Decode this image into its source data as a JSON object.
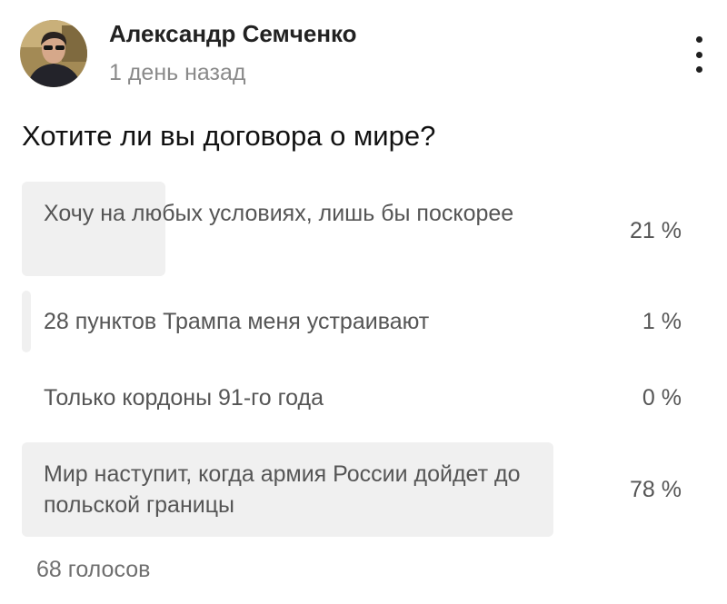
{
  "post": {
    "author": "Александр Семченко",
    "time": "1 день назад",
    "avatar_icon": "person-photo-avatar",
    "menu_icon": "vertical-dots-icon"
  },
  "poll": {
    "question": "Хотите ли вы договора о мире?",
    "fill_color": "#f0f0f0",
    "options": [
      {
        "label": "Хочу на любых условиях, лишь бы поскорее",
        "percent": "21 %",
        "share": 0.21
      },
      {
        "label": "28 пунктов Трампа меня устраивают",
        "percent": "1 %",
        "share": 0.01
      },
      {
        "label": "Только кордоны 91-го года",
        "percent": "0 %",
        "share": 0.0
      },
      {
        "label": "Мир наступит, когда армия России дойдет до польской границы",
        "percent": "78 %",
        "share": 0.78
      }
    ],
    "votes": "68 голосов"
  }
}
